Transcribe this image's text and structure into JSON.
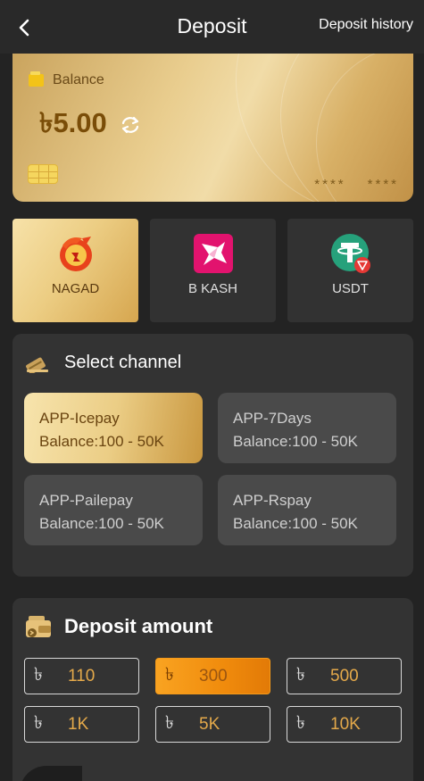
{
  "header": {
    "title": "Deposit",
    "history_label": "Deposit history"
  },
  "balance_card": {
    "label": "Balance",
    "amount": "৳5.00",
    "masked_left": "****",
    "masked_right": "****"
  },
  "methods": [
    {
      "label": "NAGAD",
      "icon": "nagad-logo",
      "selected": true
    },
    {
      "label": "B KASH",
      "icon": "bkash-logo",
      "selected": false
    },
    {
      "label": "USDT",
      "icon": "usdt-logo",
      "selected": false
    }
  ],
  "channel_section": {
    "title": "Select channel",
    "channels": [
      {
        "name": "APP-Icepay",
        "range": "Balance:100 - 50K",
        "selected": true
      },
      {
        "name": "APP-7Days",
        "range": "Balance:100 - 50K",
        "selected": false
      },
      {
        "name": "APP-Pailepay",
        "range": "Balance:100 - 50K",
        "selected": false
      },
      {
        "name": "APP-Rspay",
        "range": "Balance:100 - 50K",
        "selected": false
      }
    ]
  },
  "amount_section": {
    "title": "Deposit amount",
    "currency_symbol": "৳",
    "options": [
      {
        "value": "110",
        "selected": false
      },
      {
        "value": "300",
        "selected": true
      },
      {
        "value": "500",
        "selected": false
      },
      {
        "value": "1K",
        "selected": false
      },
      {
        "value": "5K",
        "selected": false
      },
      {
        "value": "10K",
        "selected": false
      }
    ]
  },
  "colors": {
    "background": "#232323",
    "panel": "#333333",
    "gold_accent": "#e9cd8e",
    "orange_accent": "#f08b0c",
    "amount_text": "#e4a94a"
  }
}
